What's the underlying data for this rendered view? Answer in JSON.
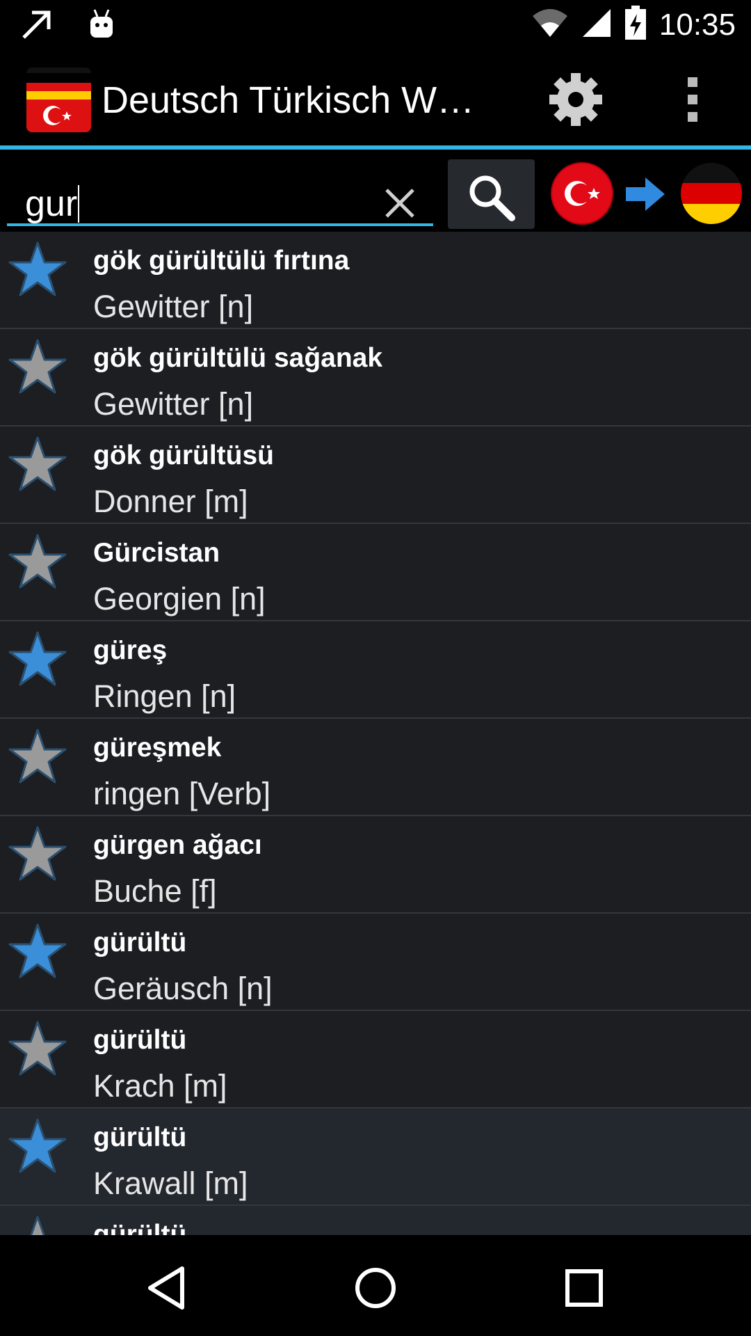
{
  "status_bar": {
    "time": "10:35",
    "icons": [
      "arrow-up-right-icon",
      "android-robot-icon",
      "wifi-icon",
      "signal-icon",
      "battery-charging-icon"
    ]
  },
  "action_bar": {
    "title": "Deutsch Türkisch Wör...",
    "app_icon": "turkish-flag-app-icon",
    "settings_icon": "gear-icon",
    "overflow_icon": "overflow-menu-icon"
  },
  "search": {
    "value": "gur",
    "clear_icon": "close-icon",
    "search_icon": "search-icon",
    "from_language_icon": "turkey-flag-icon",
    "direction_icon": "arrow-right-icon",
    "to_language_icon": "germany-flag-icon"
  },
  "colors": {
    "accent": "#33b5e5",
    "star_favorite": "#3a8fd8",
    "star_normal": "#9a9a9a",
    "list_background": "#1c1e22"
  },
  "entries": [
    {
      "turkish": "gök gürültülü fırtına",
      "german": "Gewitter [n]",
      "favorite": true
    },
    {
      "turkish": "gök gürültülü sağanak",
      "german": "Gewitter [n]",
      "favorite": false
    },
    {
      "turkish": "gök gürültüsü",
      "german": "Donner [m]",
      "favorite": false
    },
    {
      "turkish": "Gürcistan",
      "german": "Georgien [n]",
      "favorite": false
    },
    {
      "turkish": "güreş",
      "german": "Ringen [n]",
      "favorite": true
    },
    {
      "turkish": "güreşmek",
      "german": "ringen [Verb]",
      "favorite": false
    },
    {
      "turkish": "gürgen ağacı",
      "german": "Buche [f]",
      "favorite": false
    },
    {
      "turkish": "gürültü",
      "german": "Geräusch [n]",
      "favorite": true
    },
    {
      "turkish": "gürültü",
      "german": "Krach [m]",
      "favorite": false
    },
    {
      "turkish": "gürültü",
      "german": "Krawall [m]",
      "favorite": true
    },
    {
      "turkish": "gürültü",
      "german": "",
      "favorite": false
    }
  ],
  "nav_bar": {
    "back_icon": "back-icon",
    "home_icon": "home-icon",
    "recents_icon": "recents-icon"
  }
}
